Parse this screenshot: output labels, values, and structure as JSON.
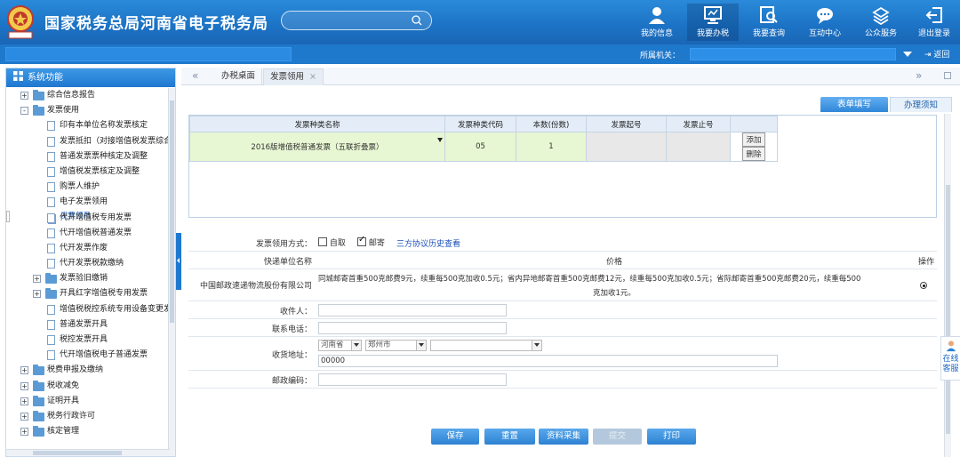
{
  "header": {
    "title": "国家税务总局河南省电子税务局",
    "search_placeholder": "",
    "nav": [
      {
        "label": "我的信息",
        "icon": "user-icon"
      },
      {
        "label": "我要办税",
        "icon": "monitor-icon"
      },
      {
        "label": "我要查询",
        "icon": "query-icon"
      },
      {
        "label": "互动中心",
        "icon": "chat-icon"
      },
      {
        "label": "公众服务",
        "icon": "service-icon"
      },
      {
        "label": "退出登录",
        "icon": "logout-icon"
      }
    ]
  },
  "subbar": {
    "org_label": "所属机关：",
    "back_label": "返回"
  },
  "sidebar": {
    "title": "系统功能",
    "items": [
      {
        "label": "综合信息报告",
        "type": "folder",
        "toggle": "+"
      },
      {
        "label": "发票使用",
        "type": "folder",
        "toggle": "-"
      },
      {
        "label": "印有本单位名称发票核定",
        "type": "doc"
      },
      {
        "label": "发票抵扣（对接增值税发票综合",
        "type": "doc"
      },
      {
        "label": "普通发票票种核定及调整",
        "type": "doc"
      },
      {
        "label": "增值税发票核定及调整",
        "type": "doc"
      },
      {
        "label": "购票人维护",
        "type": "doc"
      },
      {
        "label": "电子发票领用",
        "type": "doc"
      },
      {
        "label": "发票领用",
        "type": "doc",
        "selected": true
      },
      {
        "label": "代开增值税专用发票",
        "type": "doc"
      },
      {
        "label": "代开增值税普通发票",
        "type": "doc"
      },
      {
        "label": "代开发票作废",
        "type": "doc"
      },
      {
        "label": "代开发票税款缴纳",
        "type": "doc"
      },
      {
        "label": "发票验旧缴销",
        "type": "subfolder",
        "toggle": "+"
      },
      {
        "label": "开具红字增值税专用发票",
        "type": "subfolder",
        "toggle": "+"
      },
      {
        "label": "增值税税控系统专用设备变更发",
        "type": "doc"
      },
      {
        "label": "普通发票开具",
        "type": "doc"
      },
      {
        "label": "税控发票开具",
        "type": "doc"
      },
      {
        "label": "代开增值税电子普通发票",
        "type": "doc"
      },
      {
        "label": "税费申报及缴纳",
        "type": "folder",
        "toggle": "+"
      },
      {
        "label": "税收减免",
        "type": "folder",
        "toggle": "+"
      },
      {
        "label": "证明开具",
        "type": "folder",
        "toggle": "+"
      },
      {
        "label": "税务行政许可",
        "type": "folder",
        "toggle": "+"
      },
      {
        "label": "核定管理",
        "type": "folder",
        "toggle": "+"
      }
    ]
  },
  "tabs": {
    "prev": "«",
    "next": "»",
    "home": "办税桌面",
    "invoice": "发票领用",
    "close": "×"
  },
  "right_tabs": {
    "form": "表单填写",
    "notes": "办理须知"
  },
  "grid": {
    "headers": [
      "发票种类名称",
      "发票种类代码",
      "本数(份数)",
      "发票起号",
      "发票止号"
    ],
    "row": {
      "name": "2016版增值税普通发票（五联折叠票）",
      "code": "05",
      "count": "1",
      "start": "",
      "end": ""
    },
    "add_label": "添加",
    "delete_label": "删除"
  },
  "form": {
    "method_label": "发票领用方式：",
    "pickup_label": "自取",
    "mail_label": "邮寄",
    "history_link": "三方协议历史查看",
    "courier_header": "快递单位名称",
    "price_header": "价格",
    "op_header": "操作",
    "courier_name": "中国邮政速递物流股份有限公司",
    "price_line1": "同城邮寄首重500克邮费9元，续重每500克加收0.5元；省内异地邮寄首重500克邮费12元，续重每500克加收0.5元；省际邮寄首重500克邮费20元，续重每500",
    "price_line2": "克加收1元。",
    "recipient_label": "收件人：",
    "phone_label": "联系电话：",
    "address_label": "收货地址：",
    "province": "河南省",
    "city": "郑州市",
    "district": "",
    "address_detail": "00000",
    "postcode_label": "邮政编码："
  },
  "buttons": {
    "save": "保存",
    "reset": "重置",
    "collect": "资料采集",
    "submit": "提交",
    "print": "打印"
  },
  "online_service": {
    "line1": "在线",
    "line2": "客服"
  },
  "colors": {
    "header_blue": "#1c72c4",
    "accent": "#2d82d2",
    "green_row": "#e8f7d3"
  }
}
